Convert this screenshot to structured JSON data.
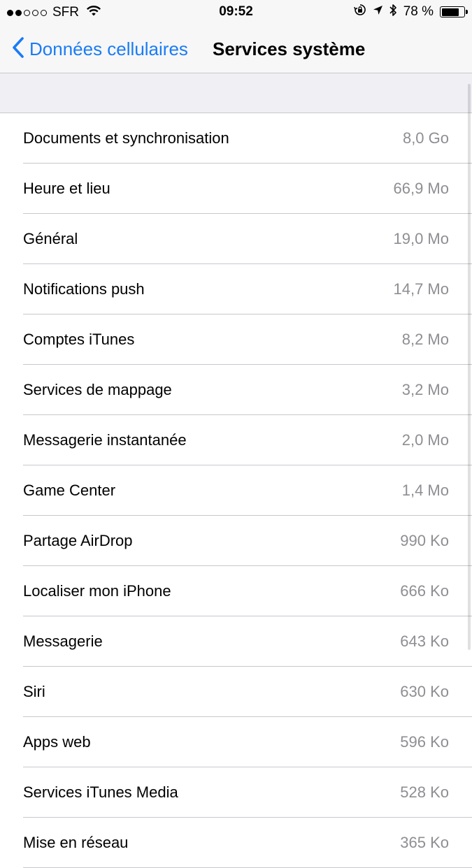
{
  "status_bar": {
    "signal_full_dots": 2,
    "signal_total_dots": 5,
    "carrier": "SFR",
    "time": "09:52",
    "battery_percent_label": "78 %",
    "battery_level": 0.78,
    "icons": [
      "wifi-icon",
      "orientation-lock-icon",
      "location-arrow-icon",
      "bluetooth-icon",
      "battery-icon"
    ]
  },
  "nav": {
    "back_label": "Données cellulaires",
    "title": "Services système",
    "accent_color": "#1a7cf5"
  },
  "items": [
    {
      "label": "Documents et synchronisation",
      "value": "8,0 Go"
    },
    {
      "label": "Heure et lieu",
      "value": "66,9 Mo"
    },
    {
      "label": "Général",
      "value": "19,0 Mo"
    },
    {
      "label": "Notifications push",
      "value": "14,7 Mo"
    },
    {
      "label": "Comptes iTunes",
      "value": "8,2 Mo"
    },
    {
      "label": "Services de mappage",
      "value": "3,2 Mo"
    },
    {
      "label": "Messagerie instantanée",
      "value": "2,0 Mo"
    },
    {
      "label": "Game Center",
      "value": "1,4 Mo"
    },
    {
      "label": "Partage AirDrop",
      "value": "990 Ko"
    },
    {
      "label": "Localiser mon iPhone",
      "value": "666 Ko"
    },
    {
      "label": "Messagerie",
      "value": "643 Ko"
    },
    {
      "label": "Siri",
      "value": "630 Ko"
    },
    {
      "label": "Apps web",
      "value": "596 Ko"
    },
    {
      "label": "Services iTunes Media",
      "value": "528 Ko"
    },
    {
      "label": "Mise en réseau",
      "value": "365 Ko"
    }
  ]
}
